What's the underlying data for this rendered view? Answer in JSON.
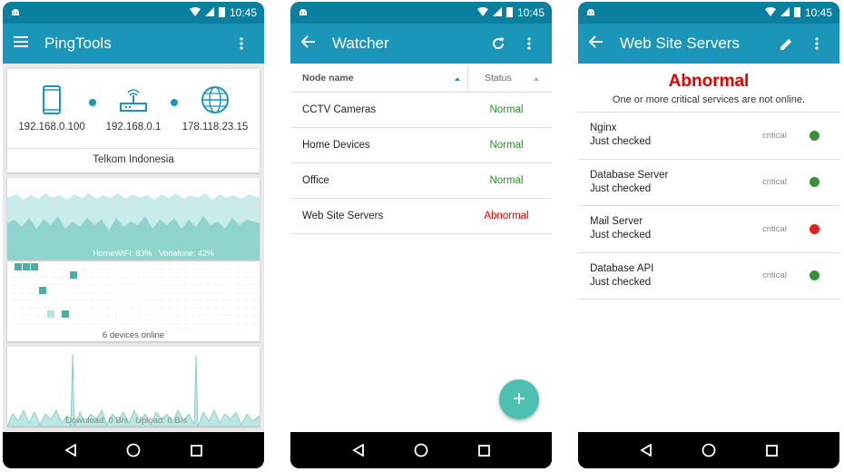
{
  "status": {
    "time": "10:45"
  },
  "colors": {
    "normal": "#2e8b2e",
    "abnormal": "#e00000",
    "ok_dot": "#3b8f3b",
    "bad_dot": "#e02020",
    "appbar": "#1b96b8"
  },
  "phone1": {
    "title": "PingTools",
    "nodes": [
      {
        "ip": "192.168.0.100",
        "icon": "phone-icon"
      },
      {
        "ip": "192.168.0.1",
        "icon": "router-icon"
      },
      {
        "ip": "178.118.23.15",
        "icon": "globe-icon"
      }
    ],
    "isp": "Telkom Indonesia",
    "wifi_label": "HomeWiFi: 83%",
    "cell_label": "Vodafone: 42%",
    "devices_label": "6 devices online",
    "download_label": "Download: 0 B/s",
    "upload_label": "Upload: 0 B/s"
  },
  "phone2": {
    "title": "Watcher",
    "col_name": "Node name",
    "col_status": "Status",
    "rows": [
      {
        "name": "CCTV Cameras",
        "status": "Normal"
      },
      {
        "name": "Home Devices",
        "status": "Normal"
      },
      {
        "name": "Office",
        "status": "Normal"
      },
      {
        "name": "Web Site Servers",
        "status": "Abnormal"
      }
    ],
    "fab": "+"
  },
  "phone3": {
    "title": "Web Site Servers",
    "state": "Abnormal",
    "message": "One or more critical services are not online.",
    "servers": [
      {
        "name": "Nginx",
        "checked": "Just checked",
        "level": "critical",
        "ok": true
      },
      {
        "name": "Database Server",
        "checked": "Just checked",
        "level": "critical",
        "ok": true
      },
      {
        "name": "Mail Server",
        "checked": "Just checked",
        "level": "critical",
        "ok": false
      },
      {
        "name": "Database API",
        "checked": "Just checked",
        "level": "critical",
        "ok": true
      }
    ]
  }
}
